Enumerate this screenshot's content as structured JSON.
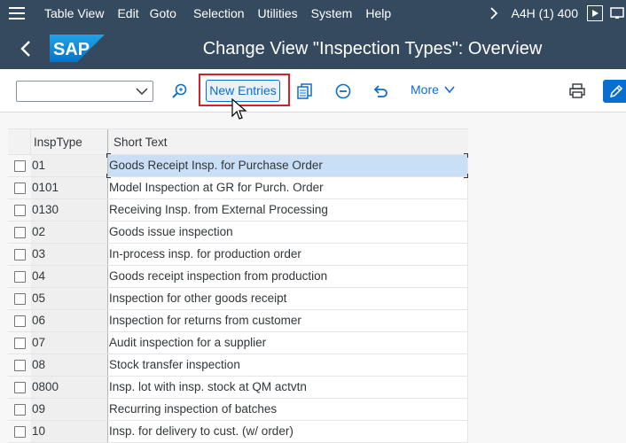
{
  "menu": {
    "items": [
      {
        "label": "Table View",
        "key": "table_view"
      },
      {
        "label": "Edit",
        "key": "edit"
      },
      {
        "label": "Goto",
        "key": "goto"
      },
      {
        "label": "Selection",
        "key": "selection"
      },
      {
        "label": "Utilities",
        "key": "utilities"
      },
      {
        "label": "System",
        "key": "system"
      },
      {
        "label": "Help",
        "key": "help"
      }
    ],
    "system_info": "A4H (1) 400"
  },
  "header": {
    "logo_text": "SAP",
    "title": "Change View \"Inspection Types\": Overview"
  },
  "toolbar": {
    "combo_value": "",
    "new_entries_label": "New Entries",
    "more_label": "More"
  },
  "table": {
    "columns": [
      "InspType",
      "Short Text"
    ],
    "rows": [
      {
        "type": "01",
        "text": "Goods Receipt Insp. for Purchase Order",
        "selected": true
      },
      {
        "type": "0101",
        "text": "Model Inspection at GR for Purch. Order"
      },
      {
        "type": "0130",
        "text": "Receiving Insp. from External Processing"
      },
      {
        "type": "02",
        "text": "Goods issue inspection"
      },
      {
        "type": "03",
        "text": "In-process insp. for production order"
      },
      {
        "type": "04",
        "text": "Goods receipt inspection from production"
      },
      {
        "type": "05",
        "text": "Inspection for other goods receipt"
      },
      {
        "type": "06",
        "text": "Inspection for returns from customer"
      },
      {
        "type": "07",
        "text": "Audit inspection for a supplier"
      },
      {
        "type": "08",
        "text": "Stock transfer inspection"
      },
      {
        "type": "0800",
        "text": "Insp. lot with insp. stock at QM actvtn"
      },
      {
        "type": "09",
        "text": "Recurring inspection of batches"
      },
      {
        "type": "10",
        "text": "Insp. for delivery to cust. (w/ order)"
      }
    ]
  },
  "colors": {
    "shell": "#354a5f",
    "accent": "#0a6ed1",
    "highlight": "#d1212a",
    "selected_row": "#c9dff5"
  },
  "icons": {
    "menu": "hamburger-icon",
    "nav": "chevron-right-icon",
    "back": "back-arrow-icon",
    "search": "zoom-icon",
    "copy": "copy-as-icon",
    "delete": "delete-icon",
    "undo": "undo-icon",
    "print": "print-icon",
    "edit": "edit-icon"
  }
}
